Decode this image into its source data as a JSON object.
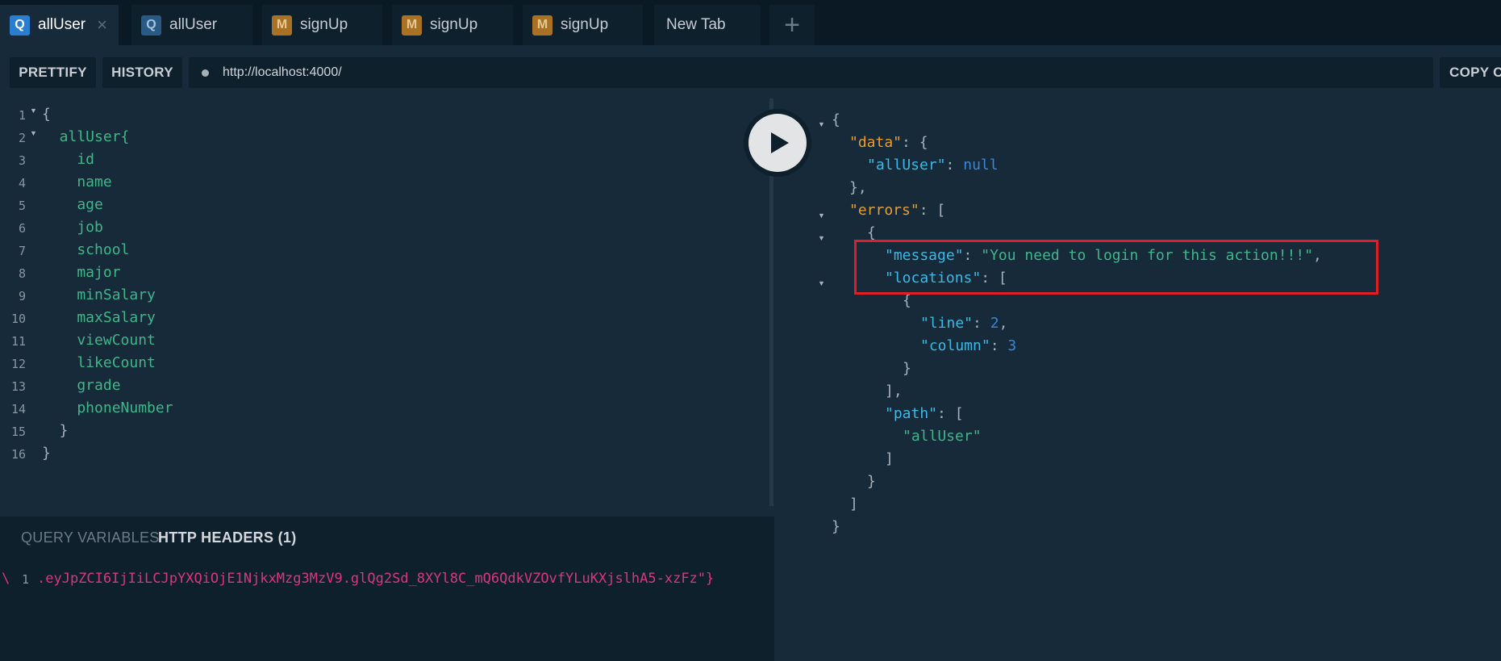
{
  "tabs": [
    {
      "badge": "Q",
      "label": "allUser",
      "active": true
    },
    {
      "badge": "Q",
      "label": "allUser",
      "active": false
    },
    {
      "badge": "M",
      "label": "signUp",
      "active": false
    },
    {
      "badge": "M",
      "label": "signUp",
      "active": false
    },
    {
      "badge": "M",
      "label": "signUp",
      "active": false
    },
    {
      "badge": "",
      "label": "New Tab",
      "active": false
    }
  ],
  "tab_close_glyph": "×",
  "tab_add_glyph": "+",
  "toolbar": {
    "prettify_label": "PRETTIFY",
    "history_label": "HISTORY",
    "url": "http://localhost:4000/",
    "copy_label": "COPY C"
  },
  "editor": {
    "line_numbers": [
      "1",
      "2",
      "3",
      "4",
      "5",
      "6",
      "7",
      "8",
      "9",
      "10",
      "11",
      "12",
      "13",
      "14",
      "15",
      "16"
    ],
    "lines": [
      "{",
      "  allUser{",
      "    id",
      "    name",
      "    age",
      "    job",
      "    school",
      "    major",
      "    minSalary",
      "    maxSalary",
      "    viewCount",
      "    likeCount",
      "    grade",
      "    phoneNumber",
      "  }",
      "}"
    ]
  },
  "variables": {
    "tab_query_variables": "QUERY VARIABLES",
    "tab_http_headers": "HTTP HEADERS (1)",
    "line_number": "1",
    "line_prefix": "\\",
    "line_text": ".eyJpZCI6IjIiLCJpYXQiOjE1NjkxMzg3MzV9.glQg2Sd_8XYl8C_mQ6QdkVZOvfYLuKXjslhA5-xzFz\"}"
  },
  "result": {
    "lines": [
      {
        "indent": 0,
        "parts": [
          [
            "p",
            "{"
          ]
        ]
      },
      {
        "indent": 1,
        "parts": [
          [
            "t",
            "\"data\""
          ],
          [
            "p",
            ": {"
          ]
        ]
      },
      {
        "indent": 2,
        "parts": [
          [
            "k",
            "\"allUser\""
          ],
          [
            "p",
            ": "
          ],
          [
            "n",
            "null"
          ]
        ]
      },
      {
        "indent": 1,
        "parts": [
          [
            "p",
            "},"
          ]
        ]
      },
      {
        "indent": 1,
        "parts": [
          [
            "t",
            "\"errors\""
          ],
          [
            "p",
            ": ["
          ]
        ]
      },
      {
        "indent": 2,
        "parts": [
          [
            "p",
            "{"
          ]
        ]
      },
      {
        "indent": 3,
        "parts": [
          [
            "k",
            "\"message\""
          ],
          [
            "p",
            ": "
          ],
          [
            "s",
            "\"You need to login for this action!!!\""
          ],
          [
            "p",
            ","
          ]
        ]
      },
      {
        "indent": 3,
        "parts": [
          [
            "k",
            "\"locations\""
          ],
          [
            "p",
            ": ["
          ]
        ]
      },
      {
        "indent": 4,
        "parts": [
          [
            "p",
            "{"
          ]
        ]
      },
      {
        "indent": 5,
        "parts": [
          [
            "k",
            "\"line\""
          ],
          [
            "p",
            ": "
          ],
          [
            "n",
            "2"
          ],
          [
            "p",
            ","
          ]
        ]
      },
      {
        "indent": 5,
        "parts": [
          [
            "k",
            "\"column\""
          ],
          [
            "p",
            ": "
          ],
          [
            "n",
            "3"
          ]
        ]
      },
      {
        "indent": 4,
        "parts": [
          [
            "p",
            "}"
          ]
        ]
      },
      {
        "indent": 3,
        "parts": [
          [
            "p",
            "],"
          ]
        ]
      },
      {
        "indent": 3,
        "parts": [
          [
            "k",
            "\"path\""
          ],
          [
            "p",
            ": ["
          ]
        ]
      },
      {
        "indent": 4,
        "parts": [
          [
            "s",
            "\"allUser\""
          ]
        ]
      },
      {
        "indent": 3,
        "parts": [
          [
            "p",
            "]"
          ]
        ]
      },
      {
        "indent": 2,
        "parts": [
          [
            "p",
            "}"
          ]
        ]
      },
      {
        "indent": 1,
        "parts": [
          [
            "p",
            "]"
          ]
        ]
      },
      {
        "indent": 0,
        "parts": [
          [
            "p",
            "}"
          ]
        ]
      }
    ]
  },
  "icons": {
    "run": "play-icon",
    "fold": "fold-arrow-icon",
    "url_status": "status-dot-icon"
  },
  "colors": {
    "highlight_box": "#e01e26",
    "query_badge": "#2a7ed2",
    "mutation_badge": "#d4932b",
    "json_key": "#3bb9e6",
    "json_string": "#3fb68a",
    "json_number": "#3a86d9",
    "json_top_key": "#e89d2f",
    "header_value": "#d6387d"
  }
}
